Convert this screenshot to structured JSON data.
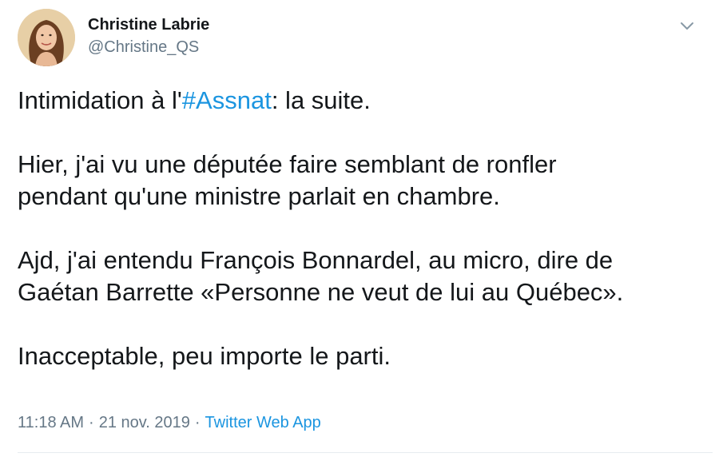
{
  "author": {
    "display_name": "Christine Labrie",
    "handle": "@Christine_QS"
  },
  "tweet": {
    "line1_before": "Intimidation à l'",
    "hashtag": "#Assnat",
    "line1_after": ": la suite.",
    "para2_line1": "Hier, j'ai vu une députée faire semblant de ronfler",
    "para2_line2": "pendant qu'une ministre parlait en chambre.",
    "para3_line1": "Ajd, j'ai entendu François Bonnardel, au micro, dire de",
    "para3_line2": "Gaétan Barrette «Personne ne veut de lui au Québec».",
    "para4": "Inacceptable, peu importe le parti."
  },
  "meta": {
    "time": "11:18 AM",
    "separator": "·",
    "date": "21 nov. 2019",
    "source": "Twitter Web App"
  },
  "icons": {
    "menu": "chevron-down-icon"
  },
  "colors": {
    "link": "#1b95e0",
    "secondary_text": "#657786",
    "primary_text": "#14171a"
  }
}
